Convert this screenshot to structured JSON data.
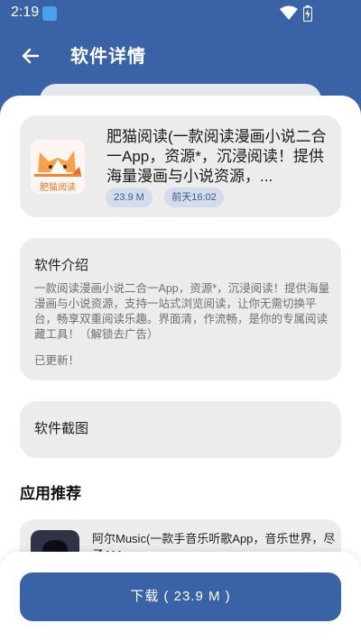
{
  "status_bar": {
    "time": "2:19",
    "icons": [
      "app-notification-icon",
      "wifi-icon",
      "battery-icon"
    ]
  },
  "header": {
    "back_icon": "arrow-left-icon",
    "title": "软件详情"
  },
  "app": {
    "name": "肥猫阅读(一款阅读漫画小说二合一App，资源*，沉浸阅读！提供海量漫画与小说资源，...",
    "icon_text": "肥猫阅读",
    "size": "23.9 M",
    "updated": "前天16:02"
  },
  "intro": {
    "title": "软件介绍",
    "text": "一款阅读漫画小说二合一App，资源*，沉浸阅读！提供海量漫画与小说资源，支持一站式浏览阅读，让你无需切换平台，畅享双重阅读乐趣。界面清，作流畅，是你的专属阅读藏工具！（解锁去广告）",
    "updated_note": "已更新！"
  },
  "screenshots": {
    "title": "软件截图"
  },
  "recommend": {
    "heading": "应用推荐",
    "items": [
      {
        "name": "阿尔Music(一款手音乐听歌App，音乐世界，尽子AM..."
      }
    ]
  },
  "download": {
    "label": "下载 ( 23.9 M )"
  },
  "colors": {
    "primary": "#3a63a7",
    "card_bg": "#ececec",
    "badge_bg": "#d4dceb",
    "badge_text": "#3c5a8c"
  }
}
